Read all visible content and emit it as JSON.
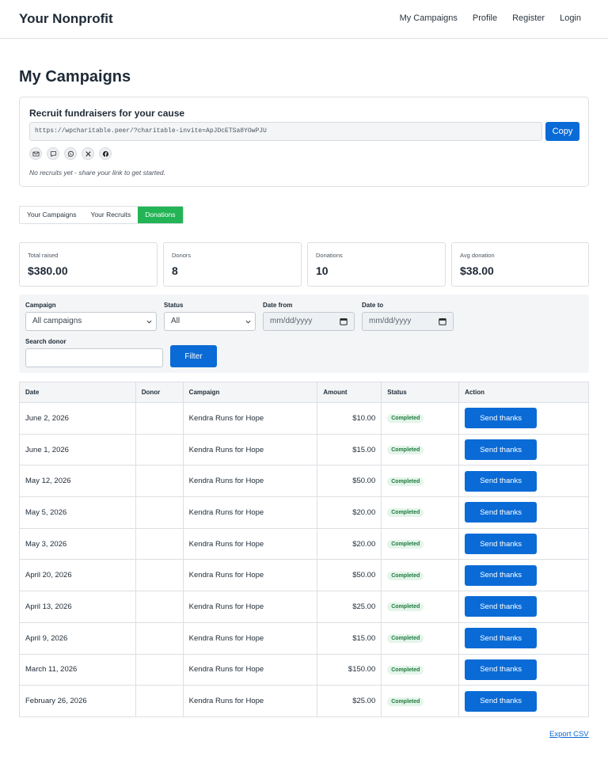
{
  "header": {
    "brand": "Your Nonprofit",
    "nav": [
      "My Campaigns",
      "Profile",
      "Register",
      "Login"
    ]
  },
  "page": {
    "title": "My Campaigns"
  },
  "recruit": {
    "title": "Recruit fundraisers for your cause",
    "invite_link": "https://wpcharitable.peer/?charitable-invite=ApJDcETSa8YOwPJU",
    "copy_label": "Copy",
    "share_icons": [
      "email-icon",
      "sms-icon",
      "whatsapp-icon",
      "x-icon",
      "facebook-icon"
    ],
    "note": "No recruits yet - share your link to get started."
  },
  "tabs": [
    {
      "label": "Your Campaigns",
      "active": false
    },
    {
      "label": "Your Recruits",
      "active": false
    },
    {
      "label": "Donations",
      "active": true
    }
  ],
  "stats": [
    {
      "label": "Total raised",
      "value": "$380.00"
    },
    {
      "label": "Donors",
      "value": "8"
    },
    {
      "label": "Donations",
      "value": "10"
    },
    {
      "label": "Avg donation",
      "value": "$38.00"
    }
  ],
  "filters": {
    "campaign_label": "Campaign",
    "campaign_value": "All campaigns",
    "status_label": "Status",
    "status_value": "All",
    "date_from_label": "Date from",
    "date_from_placeholder": "mm/dd/yyyy",
    "date_to_label": "Date to",
    "date_to_placeholder": "mm/dd/yyyy",
    "search_label": "Search donor",
    "search_value": "",
    "filter_label": "Filter"
  },
  "table": {
    "columns": [
      "Date",
      "Donor",
      "Campaign",
      "Amount",
      "Status",
      "Action"
    ],
    "rows": [
      {
        "date": "June 2, 2026",
        "donor": "",
        "campaign": "Kendra Runs for Hope",
        "amount": "$10.00",
        "status": "Completed",
        "action": "Send thanks"
      },
      {
        "date": "June 1, 2026",
        "donor": "",
        "campaign": "Kendra Runs for Hope",
        "amount": "$15.00",
        "status": "Completed",
        "action": "Send thanks"
      },
      {
        "date": "May 12, 2026",
        "donor": "",
        "campaign": "Kendra Runs for Hope",
        "amount": "$50.00",
        "status": "Completed",
        "action": "Send thanks"
      },
      {
        "date": "May 5, 2026",
        "donor": "",
        "campaign": "Kendra Runs for Hope",
        "amount": "$20.00",
        "status": "Completed",
        "action": "Send thanks"
      },
      {
        "date": "May 3, 2026",
        "donor": "",
        "campaign": "Kendra Runs for Hope",
        "amount": "$20.00",
        "status": "Completed",
        "action": "Send thanks"
      },
      {
        "date": "April 20, 2026",
        "donor": "",
        "campaign": "Kendra Runs for Hope",
        "amount": "$50.00",
        "status": "Completed",
        "action": "Send thanks"
      },
      {
        "date": "April 13, 2026",
        "donor": "",
        "campaign": "Kendra Runs for Hope",
        "amount": "$25.00",
        "status": "Completed",
        "action": "Send thanks"
      },
      {
        "date": "April 9, 2026",
        "donor": "",
        "campaign": "Kendra Runs for Hope",
        "amount": "$15.00",
        "status": "Completed",
        "action": "Send thanks"
      },
      {
        "date": "March 11, 2026",
        "donor": "",
        "campaign": "Kendra Runs for Hope",
        "amount": "$150.00",
        "status": "Completed",
        "action": "Send thanks"
      },
      {
        "date": "February 26, 2026",
        "donor": "",
        "campaign": "Kendra Runs for Hope",
        "amount": "$25.00",
        "status": "Completed",
        "action": "Send thanks"
      }
    ]
  },
  "export_label": "Export CSV",
  "colors": {
    "primary": "#0a6bd6",
    "tab_active": "#22b455",
    "badge_bg": "#e4f5ea",
    "badge_text": "#1f7a3f"
  }
}
